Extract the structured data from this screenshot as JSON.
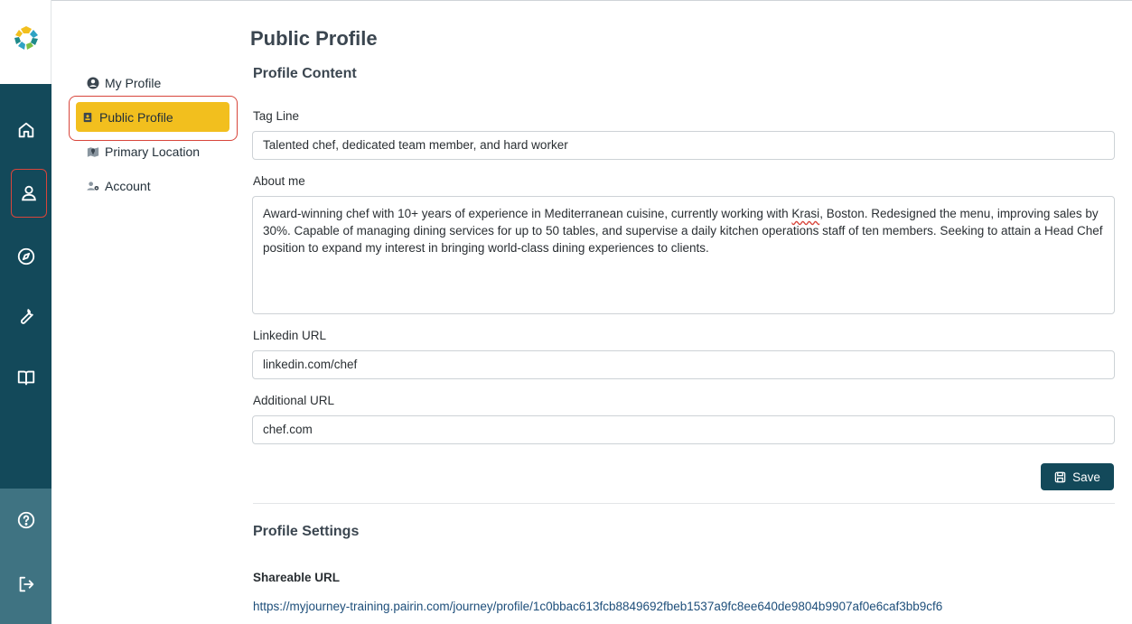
{
  "nav": {
    "items": [
      {
        "icon": "home-icon"
      },
      {
        "icon": "user-icon",
        "active": true
      },
      {
        "icon": "compass-icon"
      },
      {
        "icon": "wrench-icon"
      },
      {
        "icon": "book-icon"
      }
    ],
    "bottom": [
      {
        "icon": "help-icon"
      },
      {
        "icon": "logout-icon"
      }
    ],
    "colors": {
      "rail": "#13495a",
      "rail_bottom": "#3f7382",
      "accent": "#f2bf1e",
      "highlight": "#d8453b"
    }
  },
  "subnav": {
    "items": [
      {
        "label": "My Profile",
        "icon": "user-circle-icon"
      },
      {
        "label": "Public Profile",
        "icon": "id-badge-icon",
        "active": true
      },
      {
        "label": "Primary Location",
        "icon": "map-icon"
      },
      {
        "label": "Account",
        "icon": "user-gear-icon"
      }
    ]
  },
  "main": {
    "page_title": "Public Profile",
    "content_section_title": "Profile Content",
    "tag_line": {
      "label": "Tag Line",
      "value": "Talented chef, dedicated team member, and hard worker"
    },
    "about_me": {
      "label": "About me",
      "value_before": "Award-winning chef with 10+ years of experience in Mediterranean cuisine, currently working with ",
      "value_misspelled": "Krasi",
      "value_after": ", Boston. Redesigned the menu, improving sales by 30%. Capable of managing dining services for up to 50 tables, and supervise a daily kitchen operations staff of ten members. Seeking to attain a Head Chef position to expand my interest in bringing world-class dining experiences to clients."
    },
    "linkedin": {
      "label": "Linkedin URL",
      "value": "linkedin.com/chef"
    },
    "additional": {
      "label": "Additional URL",
      "value": "chef.com"
    },
    "save_label": "Save",
    "settings_section_title": "Profile Settings",
    "shareable_label": "Shareable URL",
    "shareable_url": "https://myjourney-training.pairin.com/journey/profile/1c0bbac613fcb8849692fbeb1537a9fc8ee640de9804b9907af0e6caf3bb9cf6"
  }
}
